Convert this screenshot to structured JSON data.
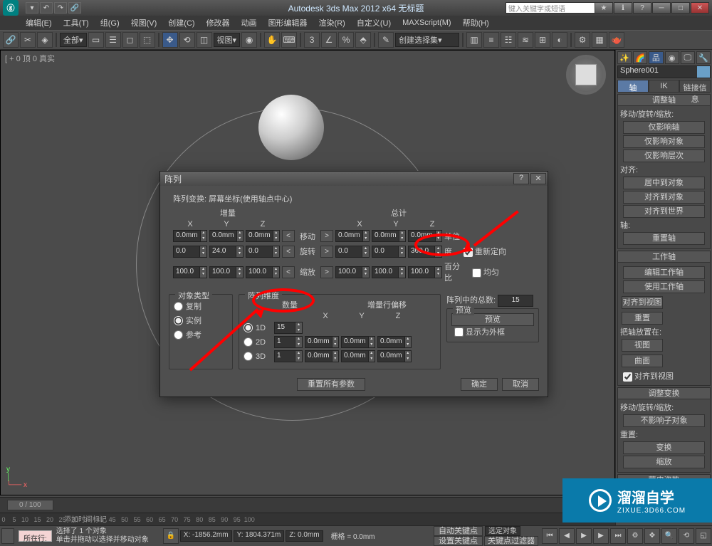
{
  "title": "Autodesk 3ds Max 2012 x64   无标题",
  "search_placeholder": "键入关键字或短语",
  "menus": [
    "编辑(E)",
    "工具(T)",
    "组(G)",
    "视图(V)",
    "创建(C)",
    "修改器",
    "动画",
    "图形编辑器",
    "渲染(R)",
    "自定义(U)",
    "MAXScript(M)",
    "帮助(H)"
  ],
  "toolbar_dropdown_all": "全部",
  "toolbar_dropdown_view": "视图",
  "toolbar_dropdown_select": "创建选择集",
  "viewport_label": "[ + 0 顶 0 真实",
  "object_name": "Sphere001",
  "pivot_tabs": {
    "axis": "轴",
    "ik": "IK",
    "link": "链接信息"
  },
  "rollouts": {
    "adjust_pivot": {
      "title": "调整轴",
      "group1": "移动/旋转/缩放:",
      "btn1": "仅影响轴",
      "btn2": "仅影响对象",
      "btn3": "仅影响层次",
      "align_label": "对齐:",
      "align1": "居中到对象",
      "align2": "对齐到对象",
      "align3": "对齐到世界",
      "pivot_label": "轴:",
      "reset": "重置轴"
    },
    "working_pivot": {
      "title": "工作轴",
      "btn1": "编辑工作轴",
      "btn2": "使用工作轴",
      "btn3": "对齐到视图",
      "btn4": "重置",
      "place_label": "把轴放置在:",
      "p1": "视图",
      "p2": "曲面",
      "cb": "对齐到视图"
    },
    "adjust_xform": {
      "title": "调整变换",
      "g1": "移动/旋转/缩放:",
      "b1": "不影响子对象",
      "g2": "重置:",
      "b2": "变换",
      "b3": "缩放"
    },
    "skin_pose": {
      "title": "蒙皮姿势"
    }
  },
  "dialog": {
    "title": "阵列",
    "trans_label": "阵列变换: 屏幕坐标(使用轴点中心)",
    "incr": "增量",
    "total": "总计",
    "axes": {
      "x": "X",
      "y": "Y",
      "z": "Z"
    },
    "move_label": "移动",
    "rotate_label": "旋转",
    "scale_label": "缩放",
    "units": "单位",
    "degrees": "度",
    "percent": "百分比",
    "reorient": "重新定向",
    "uniform": "均匀",
    "move_inc": {
      "x": "0.0mm",
      "y": "0.0mm",
      "z": "0.0mm"
    },
    "move_tot": {
      "x": "0.0mm",
      "y": "0.0mm",
      "z": "0.0mm"
    },
    "rot_inc": {
      "x": "0.0",
      "y": "24.0",
      "z": "0.0"
    },
    "rot_tot": {
      "x": "0.0",
      "y": "0.0",
      "z": "360.0"
    },
    "scl_inc": {
      "x": "100.0",
      "y": "100.0",
      "z": "100.0"
    },
    "scl_tot": {
      "x": "100.0",
      "y": "100.0",
      "z": "100.0"
    },
    "obj_type": {
      "title": "对象类型",
      "copy": "复制",
      "instance": "实例",
      "reference": "参考"
    },
    "dims": {
      "title": "阵列维度",
      "count": "数量",
      "offset": "增量行偏移",
      "d1": "1D",
      "d2": "2D",
      "d3": "3D",
      "c1": "15",
      "c2": "1",
      "c3": "1",
      "off2": {
        "x": "0.0mm",
        "y": "0.0mm",
        "z": "0.0mm"
      },
      "off3": {
        "x": "0.0mm",
        "y": "0.0mm",
        "z": "0.0mm"
      }
    },
    "total_count": {
      "label": "阵列中的总数:",
      "value": "15"
    },
    "preview": {
      "title": "预览",
      "btn": "预览",
      "cb": "显示为外框"
    },
    "reset": "重置所有参数",
    "ok": "确定",
    "cancel": "取消"
  },
  "timeline": {
    "frame": "0 / 100",
    "autokey": "自动关键点",
    "setkey": "设置关键点",
    "filters": "关键点过滤器",
    "selset": "选定对象"
  },
  "status": {
    "sel": "选择了 1 个对象",
    "hint": "单击并拖动以选择并移动对象",
    "x": "X: -1856.2mm",
    "y": "Y: 1804.371m",
    "z": "Z: 0.0mm",
    "grid": "栅格 = 0.0mm",
    "addtag": "添加时间标记",
    "track_prefix": "所在行:"
  },
  "watermark": {
    "name": "溜溜自学",
    "url": "ZIXUE.3D66.COM"
  }
}
